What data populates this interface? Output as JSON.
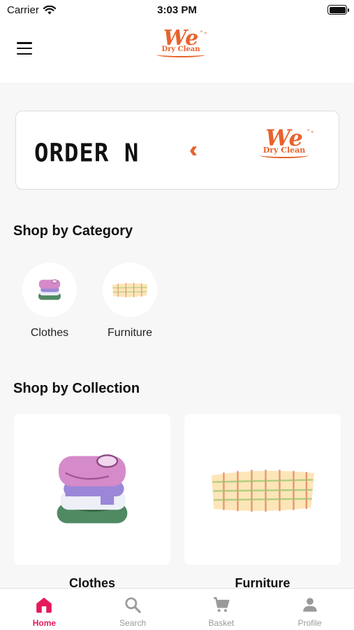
{
  "status_bar": {
    "carrier": "Carrier",
    "time": "3:03 PM"
  },
  "header": {
    "logo": {
      "word": "We",
      "subtitle": "Dry Clean"
    }
  },
  "banner": {
    "text": "ORDER N",
    "arrows": "‹‹‹",
    "logo": {
      "word": "We",
      "subtitle": "Dry Clean"
    }
  },
  "category_section": {
    "title": "Shop by Category",
    "items": [
      {
        "label": "Clothes",
        "icon": "folded-clothes-icon"
      },
      {
        "label": "Furniture",
        "icon": "plaid-blanket-icon"
      }
    ]
  },
  "collection_section": {
    "title": "Shop by Collection",
    "items": [
      {
        "label": "Clothes",
        "icon": "folded-clothes-icon"
      },
      {
        "label": "Furniture",
        "icon": "plaid-blanket-icon"
      }
    ]
  },
  "tab_bar": {
    "tabs": [
      {
        "label": "Home",
        "icon": "home-icon",
        "active": true
      },
      {
        "label": "Search",
        "icon": "search-icon",
        "active": false
      },
      {
        "label": "Basket",
        "icon": "cart-icon",
        "active": false
      },
      {
        "label": "Profile",
        "icon": "person-icon",
        "active": false
      }
    ]
  },
  "colors": {
    "brand_orange": "#e8622c",
    "active_tab": "#e5195b",
    "inactive_tab": "#9a9a9a",
    "background": "#f7f7f7"
  }
}
